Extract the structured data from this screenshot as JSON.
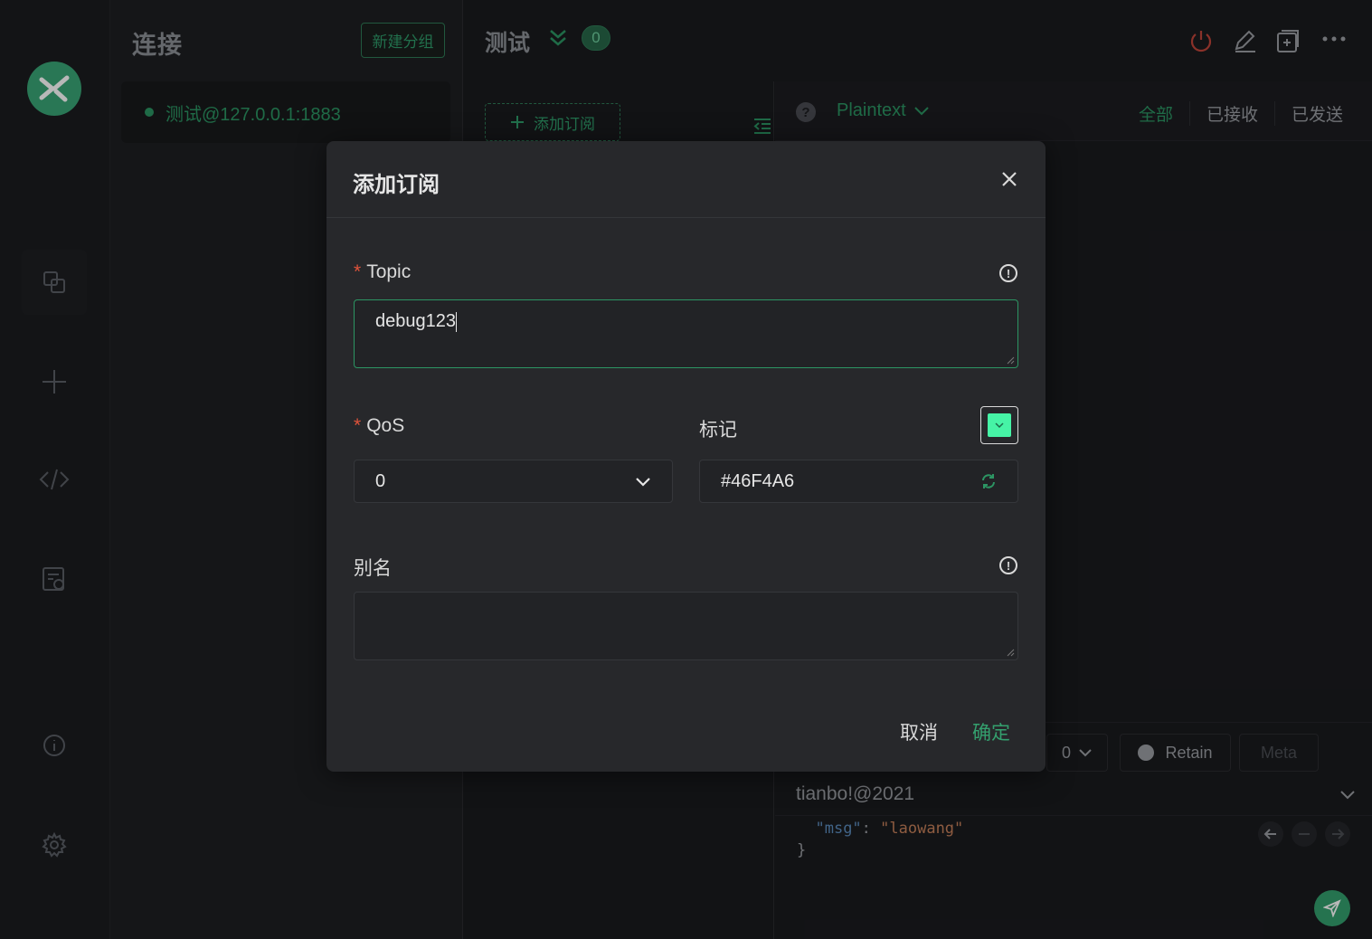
{
  "sidebar": {
    "items": [
      {
        "icon": "connections-icon",
        "active": true
      },
      {
        "icon": "plus-icon"
      },
      {
        "icon": "code-icon"
      },
      {
        "icon": "log-icon"
      },
      {
        "icon": "info-icon"
      },
      {
        "icon": "gear-icon"
      }
    ]
  },
  "connections": {
    "title": "连接",
    "new_group_label": "新建分组",
    "items": [
      {
        "name": "测试@127.0.0.1:1883",
        "status_color": "#2c9563"
      }
    ]
  },
  "main": {
    "title": "测试",
    "badge": "0",
    "add_subscription_label": "添加订阅",
    "payload_format": "Plaintext",
    "filters": [
      "全部",
      "已接收",
      "已发送"
    ],
    "compose": {
      "qos": "0",
      "retain_label": "Retain",
      "meta_label": "Meta",
      "topic": "tianbo!@2021",
      "payload_lines": [
        "{",
        "  \"msg\": \"laowang\"",
        "}"
      ],
      "payload_key": "\"msg\"",
      "payload_value": "\"laowang\""
    }
  },
  "modal": {
    "title": "添加订阅",
    "topic_label": "Topic",
    "topic_value": "debug123",
    "qos_label": "QoS",
    "qos_value": "0",
    "color_label": "标记",
    "color_value": "#46F4A6",
    "alias_label": "别名",
    "alias_value": "",
    "required_mark": "*",
    "cancel_label": "取消",
    "confirm_label": "确定"
  },
  "colors": {
    "accent": "#2c9563",
    "tag_color": "#46F4A6",
    "danger": "#c0453a"
  }
}
